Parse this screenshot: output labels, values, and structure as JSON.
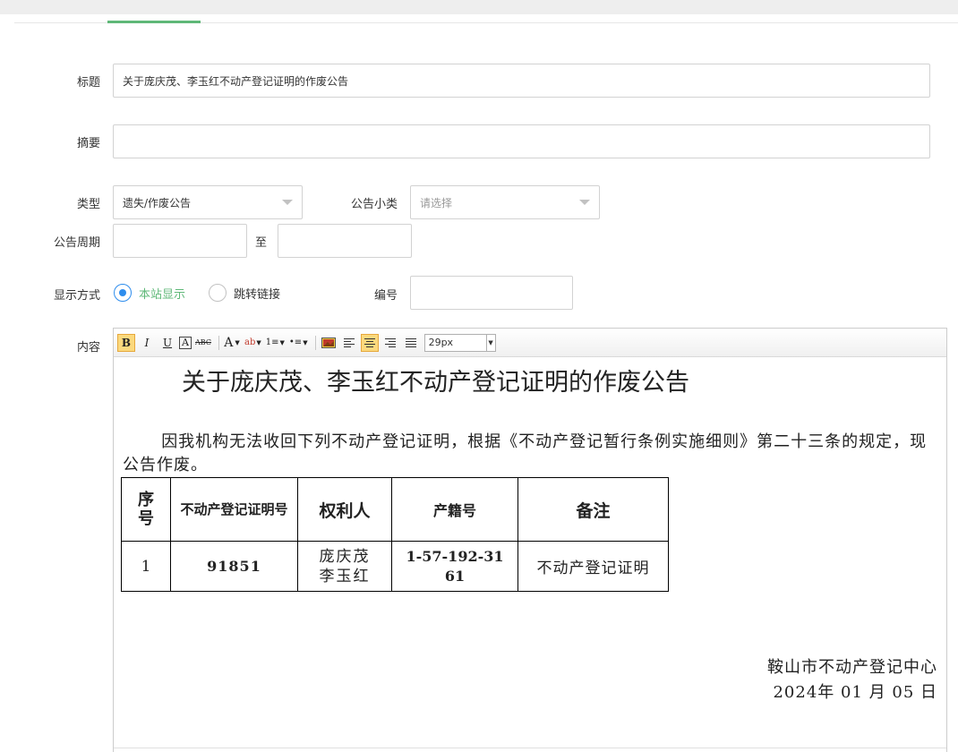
{
  "form": {
    "title_label": "标题",
    "title_value": "关于庞庆茂、李玉红不动产登记证明的作废公告",
    "summary_label": "摘要",
    "summary_value": "",
    "type_label": "类型",
    "type_value": "遗失/作废公告",
    "subtype_label": "公告小类",
    "subtype_placeholder": "请选择",
    "period_label": "公告周期",
    "period_start": "",
    "period_to": "至",
    "period_end": "",
    "display_label": "显示方式",
    "display_options": [
      "本站显示",
      "跳转链接"
    ],
    "display_selected": "本站显示",
    "number_label": "编号",
    "number_value": "",
    "content_label": "内容"
  },
  "toolbar": {
    "bold": "B",
    "italic": "I",
    "underline": "U",
    "border_char": "A",
    "strike": "ABC",
    "font_color": "A",
    "highlight": "ab",
    "ordered_list": "1≡",
    "unordered_list": "•≡",
    "font_size": "29px",
    "colors": {
      "active_bg": "#fbd97e"
    }
  },
  "document": {
    "title": "关于庞庆茂、李玉红不动产登记证明的作废公告",
    "body": "因我机构无法收回下列不动产登记证明，根据《不动产登记暂行条例实施细则》第二十三条的规定，现公告作废。",
    "table_headers": [
      "序号",
      "不动产登记证明号",
      "权利人",
      "产籍号",
      "备注"
    ],
    "table_rows": [
      [
        "1",
        "91851",
        "庞庆茂 李玉红",
        "1-57-192-3161",
        "不动产登记证明"
      ]
    ],
    "signer": "鞍山市不动产登记中心",
    "date": "2024年  01  月  05   日"
  },
  "colors": {
    "accent_green": "#5fb878",
    "radio_blue": "#2e8ded"
  }
}
